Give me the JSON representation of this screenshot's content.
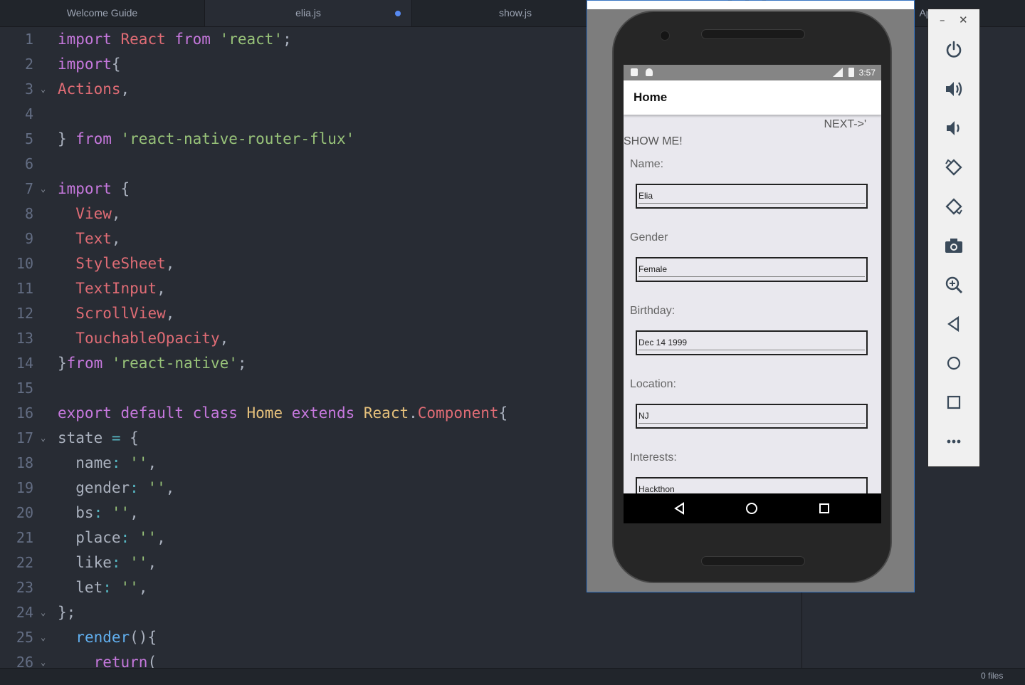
{
  "tabs": [
    {
      "label": "Welcome Guide"
    },
    {
      "label": "elia.js",
      "modified": true
    },
    {
      "label": "show.js"
    },
    {
      "label": "Ap"
    }
  ],
  "editor": {
    "lines": [
      {
        "n": "1",
        "fold": false,
        "tokens": [
          [
            "kw",
            "import "
          ],
          [
            "var",
            "React "
          ],
          [
            "kw",
            "from "
          ],
          [
            "str",
            "'react'"
          ],
          [
            "p",
            ";"
          ]
        ]
      },
      {
        "n": "2",
        "fold": false,
        "tokens": [
          [
            "kw",
            "import"
          ],
          [
            "p",
            "{"
          ]
        ]
      },
      {
        "n": "3",
        "fold": true,
        "tokens": [
          [
            "var",
            "Actions"
          ],
          [
            "p",
            ","
          ]
        ]
      },
      {
        "n": "4",
        "fold": false,
        "tokens": []
      },
      {
        "n": "5",
        "fold": false,
        "tokens": [
          [
            "p",
            "} "
          ],
          [
            "kw",
            "from "
          ],
          [
            "str",
            "'react-native-router-flux'"
          ]
        ]
      },
      {
        "n": "6",
        "fold": false,
        "tokens": []
      },
      {
        "n": "7",
        "fold": true,
        "tokens": [
          [
            "kw",
            "import "
          ],
          [
            "p",
            "{"
          ]
        ]
      },
      {
        "n": "8",
        "fold": false,
        "tokens": [
          [
            "p",
            "  "
          ],
          [
            "var",
            "View"
          ],
          [
            "p",
            ","
          ]
        ]
      },
      {
        "n": "9",
        "fold": false,
        "tokens": [
          [
            "p",
            "  "
          ],
          [
            "var",
            "Text"
          ],
          [
            "p",
            ","
          ]
        ]
      },
      {
        "n": "10",
        "fold": false,
        "tokens": [
          [
            "p",
            "  "
          ],
          [
            "var",
            "StyleSheet"
          ],
          [
            "p",
            ","
          ]
        ]
      },
      {
        "n": "11",
        "fold": false,
        "tokens": [
          [
            "p",
            "  "
          ],
          [
            "var",
            "TextInput"
          ],
          [
            "p",
            ","
          ]
        ]
      },
      {
        "n": "12",
        "fold": false,
        "tokens": [
          [
            "p",
            "  "
          ],
          [
            "var",
            "ScrollView"
          ],
          [
            "p",
            ","
          ]
        ]
      },
      {
        "n": "13",
        "fold": false,
        "tokens": [
          [
            "p",
            "  "
          ],
          [
            "var",
            "TouchableOpacity"
          ],
          [
            "p",
            ","
          ]
        ]
      },
      {
        "n": "14",
        "fold": false,
        "tokens": [
          [
            "p",
            "}"
          ],
          [
            "kw",
            "from "
          ],
          [
            "str",
            "'react-native'"
          ],
          [
            "p",
            ";"
          ]
        ]
      },
      {
        "n": "15",
        "fold": false,
        "tokens": []
      },
      {
        "n": "16",
        "fold": false,
        "tokens": [
          [
            "kw",
            "export default class "
          ],
          [
            "cls",
            "Home "
          ],
          [
            "kw",
            "extends "
          ],
          [
            "cls",
            "React"
          ],
          [
            "p",
            "."
          ],
          [
            "var",
            "Component"
          ],
          [
            "p",
            "{"
          ]
        ]
      },
      {
        "n": "17",
        "fold": true,
        "tokens": [
          [
            "p",
            "state "
          ],
          [
            "op",
            "="
          ],
          [
            "p",
            " {"
          ]
        ]
      },
      {
        "n": "18",
        "fold": false,
        "tokens": [
          [
            "p",
            "  name"
          ],
          [
            "op",
            ":"
          ],
          [
            "p",
            " "
          ],
          [
            "str",
            "''"
          ],
          [
            "p",
            ","
          ]
        ]
      },
      {
        "n": "19",
        "fold": false,
        "tokens": [
          [
            "p",
            "  gender"
          ],
          [
            "op",
            ":"
          ],
          [
            "p",
            " "
          ],
          [
            "str",
            "''"
          ],
          [
            "p",
            ","
          ]
        ]
      },
      {
        "n": "20",
        "fold": false,
        "tokens": [
          [
            "p",
            "  bs"
          ],
          [
            "op",
            ":"
          ],
          [
            "p",
            " "
          ],
          [
            "str",
            "''"
          ],
          [
            "p",
            ","
          ]
        ]
      },
      {
        "n": "21",
        "fold": false,
        "tokens": [
          [
            "p",
            "  place"
          ],
          [
            "op",
            ":"
          ],
          [
            "p",
            " "
          ],
          [
            "str",
            "''"
          ],
          [
            "p",
            ","
          ]
        ]
      },
      {
        "n": "22",
        "fold": false,
        "tokens": [
          [
            "p",
            "  like"
          ],
          [
            "op",
            ":"
          ],
          [
            "p",
            " "
          ],
          [
            "str",
            "''"
          ],
          [
            "p",
            ","
          ]
        ]
      },
      {
        "n": "23",
        "fold": false,
        "tokens": [
          [
            "p",
            "  let"
          ],
          [
            "op",
            ":"
          ],
          [
            "p",
            " "
          ],
          [
            "str",
            "''"
          ],
          [
            "p",
            ","
          ]
        ]
      },
      {
        "n": "24",
        "fold": true,
        "tokens": [
          [
            "p",
            "};"
          ]
        ]
      },
      {
        "n": "25",
        "fold": true,
        "tokens": [
          [
            "p",
            "  "
          ],
          [
            "fn",
            "render"
          ],
          [
            "p",
            "(){"
          ]
        ]
      },
      {
        "n": "26",
        "fold": true,
        "tokens": [
          [
            "p",
            "    "
          ],
          [
            "kw",
            "return"
          ],
          [
            "p",
            "("
          ]
        ]
      }
    ]
  },
  "statusbar": {
    "files": "0 files"
  },
  "emulator": {
    "status_time": "3:57",
    "appbar_title": "Home",
    "next_label": "NEXT->'",
    "show_label": "SHOW ME!",
    "fields": [
      {
        "label": "Name:",
        "value": "Elia"
      },
      {
        "label": "Gender",
        "value": "Female"
      },
      {
        "label": "Birthday:",
        "value": "Dec 14 1999"
      },
      {
        "label": "Location:",
        "value": "NJ"
      },
      {
        "label": "Interests:",
        "value": "Hackthon"
      }
    ]
  },
  "toolbar": {
    "minimize": "–",
    "close": "✕",
    "buttons": [
      "power-icon",
      "volume-up-icon",
      "volume-down-icon",
      "rotate-left-icon",
      "rotate-right-icon",
      "camera-icon",
      "zoom-icon",
      "back-icon",
      "home-icon",
      "overview-icon",
      "more-icon"
    ]
  }
}
